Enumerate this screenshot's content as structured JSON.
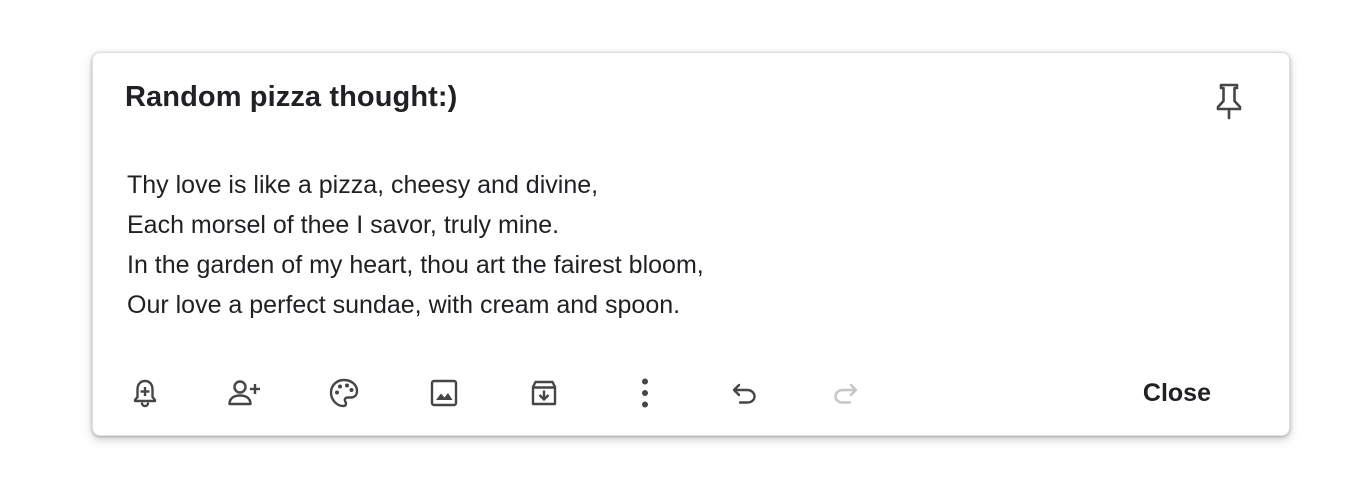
{
  "note": {
    "title": "Random pizza thought:)",
    "lines": [
      "Thy love is like a pizza, cheesy and divine,",
      "Each morsel of thee I savor, truly mine.",
      "In the garden of my heart, thou art the fairest bloom,",
      "Our love a perfect sundae, with cream and spoon."
    ]
  },
  "toolbar": {
    "icons": [
      "add-reminder-icon",
      "add-collaborator-icon",
      "palette-icon",
      "image-icon",
      "archive-icon",
      "more-vert-icon",
      "undo-icon",
      "redo-icon"
    ],
    "close_label": "Close"
  },
  "pin": {
    "icon": "pin-icon"
  },
  "colors": {
    "text": "#202124",
    "icon": "#444746",
    "icon_disabled": "#c4c7c5"
  }
}
